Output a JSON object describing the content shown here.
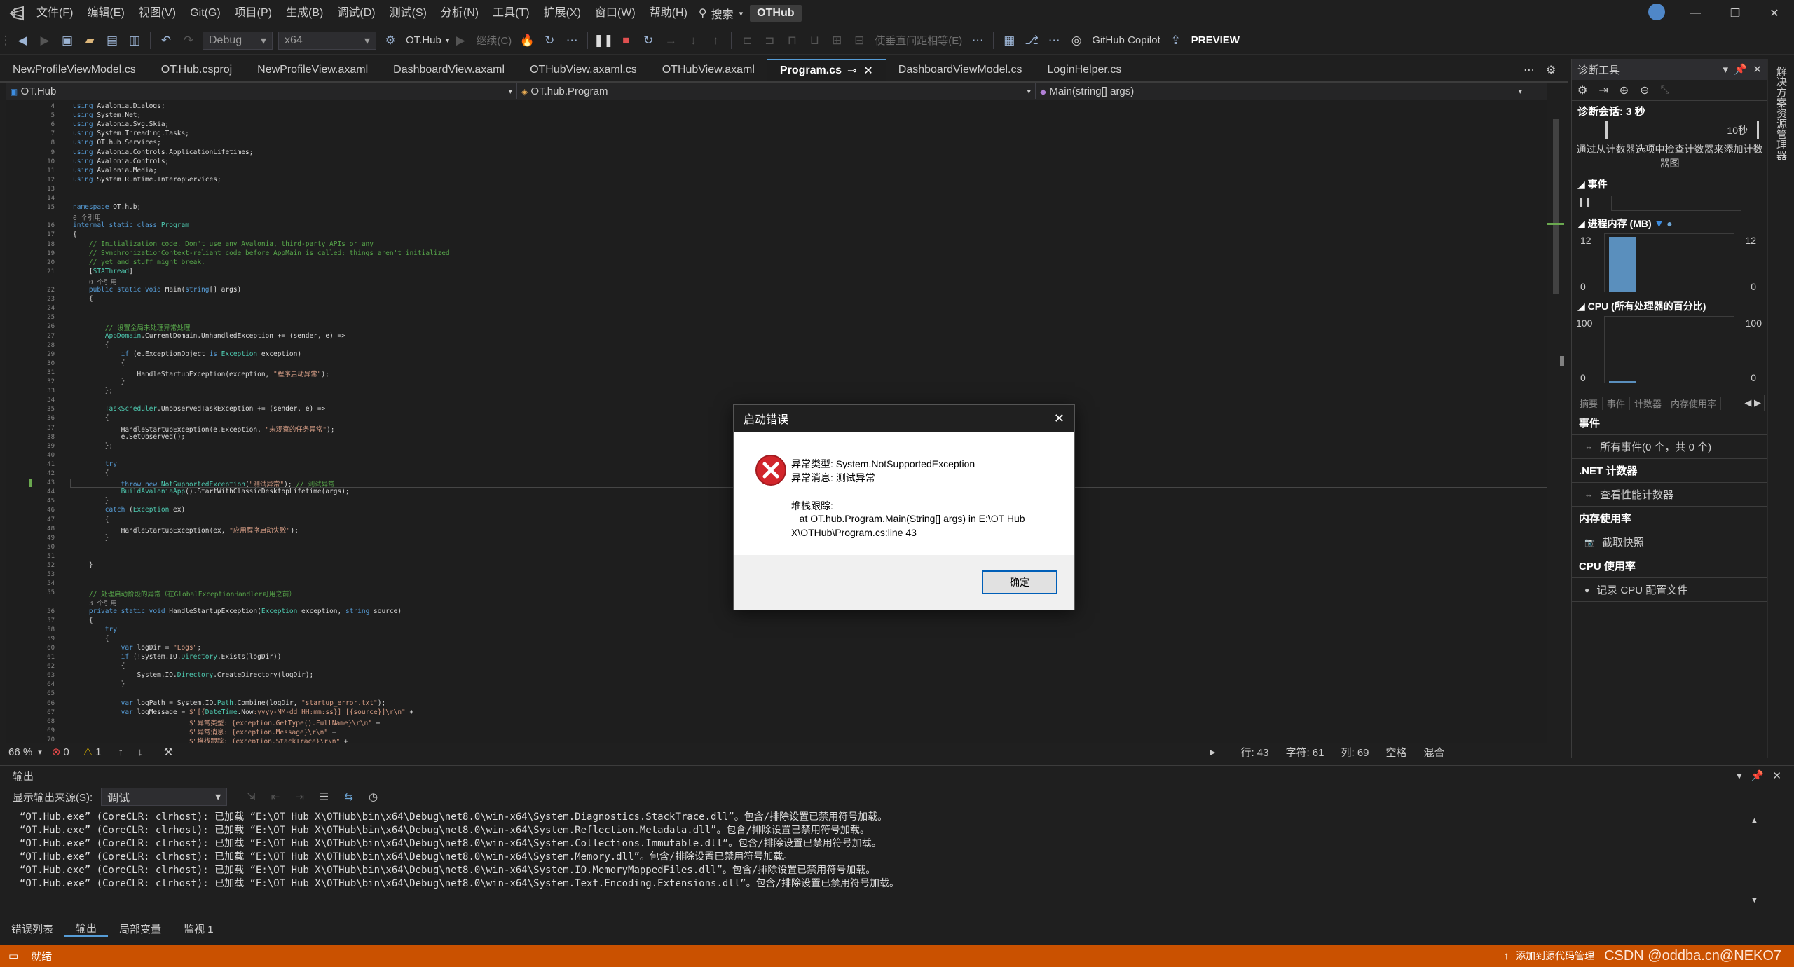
{
  "menubar": {
    "items": [
      "文件(F)",
      "编辑(E)",
      "视图(V)",
      "Git(G)",
      "项目(P)",
      "生成(B)",
      "调试(D)",
      "测试(S)",
      "分析(N)",
      "工具(T)",
      "扩展(X)",
      "窗口(W)",
      "帮助(H)"
    ],
    "search": "搜索",
    "solution": "OTHub"
  },
  "toolbar": {
    "config": "Debug",
    "platform": "x64",
    "startup": "OT.Hub",
    "continue": "继续(C)",
    "align": "使垂直间距相等(E)",
    "copilot": "GitHub Copilot",
    "preview": "PREVIEW"
  },
  "doctabs": [
    "NewProfileViewModel.cs",
    "OT.Hub.csproj",
    "NewProfileView.axaml",
    "DashboardView.axaml",
    "OTHubView.axaml.cs",
    "OTHubView.axaml",
    "Program.cs",
    "DashboardViewModel.cs",
    "LoginHelper.cs"
  ],
  "navbar": {
    "project": "OT.Hub",
    "class": "OT.hub.Program",
    "member": "Main(string[] args)"
  },
  "code": [
    {
      "n": "4",
      "t": "<span class='kw'>using</span> Avalonia.Dialogs;"
    },
    {
      "n": "5",
      "t": "<span class='kw'>using</span> System.Net;"
    },
    {
      "n": "6",
      "t": "<span class='kw'>using</span> Avalonia.Svg.Skia;"
    },
    {
      "n": "7",
      "t": "<span class='kw'>using</span> System.Threading.Tasks;"
    },
    {
      "n": "8",
      "t": "<span class='kw'>using</span> OT.hub.Services;"
    },
    {
      "n": "9",
      "t": "<span class='kw'>using</span> Avalonia.Controls.ApplicationLifetimes;"
    },
    {
      "n": "10",
      "t": "<span class='kw'>using</span> Avalonia.Controls;"
    },
    {
      "n": "11",
      "t": "<span class='kw'>using</span> Avalonia.Media;"
    },
    {
      "n": "12",
      "t": "<span class='kw'>using</span> System.Runtime.InteropServices;"
    },
    {
      "n": "13",
      "t": ""
    },
    {
      "n": "14",
      "t": ""
    },
    {
      "n": "15",
      "t": "<span class='kw'>namespace</span> OT.hub;"
    },
    {
      "n": "",
      "t": "<span class='ref'>0 个引用</span>"
    },
    {
      "n": "16",
      "t": "<span class='kw'>internal static class</span> <span class='ty'>Program</span>"
    },
    {
      "n": "17",
      "t": "{"
    },
    {
      "n": "18",
      "t": "    <span class='cm'>// Initialization code. Don't use any Avalonia, third-party APIs or any</span>"
    },
    {
      "n": "19",
      "t": "    <span class='cm'>// SynchronizationContext-reliant code before AppMain is called: things aren't initialized</span>"
    },
    {
      "n": "20",
      "t": "    <span class='cm'>// yet and stuff might break.</span>"
    },
    {
      "n": "21",
      "t": "    [<span class='ty'>STAThread</span>]"
    },
    {
      "n": "",
      "t": "    <span class='ref'>0 个引用</span>"
    },
    {
      "n": "22",
      "t": "    <span class='kw'>public static void</span> Main(<span class='kw'>string</span>[] args)"
    },
    {
      "n": "23",
      "t": "    {"
    },
    {
      "n": "24",
      "t": ""
    },
    {
      "n": "25",
      "t": ""
    },
    {
      "n": "26",
      "t": "        <span class='cm'>// 设置全局未处理异常处理</span>"
    },
    {
      "n": "27",
      "t": "        <span class='ty'>AppDomain</span>.CurrentDomain.UnhandledException += (sender, e) =>"
    },
    {
      "n": "28",
      "t": "        {"
    },
    {
      "n": "29",
      "t": "            <span class='kw'>if</span> (e.ExceptionObject <span class='kw'>is</span> <span class='ty'>Exception</span> exception)"
    },
    {
      "n": "30",
      "t": "            {"
    },
    {
      "n": "31",
      "t": "                HandleStartupException(exception, <span class='st'>\"程序启动异常\"</span>);"
    },
    {
      "n": "32",
      "t": "            }"
    },
    {
      "n": "33",
      "t": "        };"
    },
    {
      "n": "34",
      "t": ""
    },
    {
      "n": "35",
      "t": "        <span class='ty'>TaskScheduler</span>.UnobservedTaskException += (sender, e) =>"
    },
    {
      "n": "36",
      "t": "        {"
    },
    {
      "n": "37",
      "t": "            HandleStartupException(e.Exception, <span class='st'>\"未观察的任务异常\"</span>);"
    },
    {
      "n": "38",
      "t": "            e.SetObserved();"
    },
    {
      "n": "39",
      "t": "        };"
    },
    {
      "n": "40",
      "t": ""
    },
    {
      "n": "41",
      "t": "        <span class='kw'>try</span>"
    },
    {
      "n": "42",
      "t": "        {"
    },
    {
      "n": "43",
      "t": "            <span class='kw'>throw new</span> <span class='ty'>NotSupportedException</span>(<span class='st'>\"测试异常\"</span>); <span class='cm'>// 测试异常</span>"
    },
    {
      "n": "44",
      "t": "            <span class='ty'>BuildAvaloniaApp</span>().StartWithClassicDesktopLifetime(args);"
    },
    {
      "n": "45",
      "t": "        }"
    },
    {
      "n": "46",
      "t": "        <span class='kw'>catch</span> (<span class='ty'>Exception</span> ex)"
    },
    {
      "n": "47",
      "t": "        {"
    },
    {
      "n": "48",
      "t": "            HandleStartupException(ex, <span class='st'>\"应用程序启动失败\"</span>);"
    },
    {
      "n": "49",
      "t": "        }"
    },
    {
      "n": "50",
      "t": ""
    },
    {
      "n": "51",
      "t": ""
    },
    {
      "n": "52",
      "t": "    }"
    },
    {
      "n": "53",
      "t": ""
    },
    {
      "n": "54",
      "t": ""
    },
    {
      "n": "55",
      "t": "    <span class='cm'>// 处理启动阶段的异常（在GlobalExceptionHandler可用之前）</span>"
    },
    {
      "n": "",
      "t": "    <span class='ref'>3 个引用</span>"
    },
    {
      "n": "56",
      "t": "    <span class='kw'>private static void</span> HandleStartupException(<span class='ty'>Exception</span> exception, <span class='kw'>string</span> source)"
    },
    {
      "n": "57",
      "t": "    {"
    },
    {
      "n": "58",
      "t": "        <span class='kw'>try</span>"
    },
    {
      "n": "59",
      "t": "        {"
    },
    {
      "n": "60",
      "t": "            <span class='kw'>var</span> logDir = <span class='st'>\"Logs\"</span>;"
    },
    {
      "n": "61",
      "t": "            <span class='kw'>if</span> (!System.IO.<span class='ty'>Directory</span>.Exists(logDir))"
    },
    {
      "n": "62",
      "t": "            {"
    },
    {
      "n": "63",
      "t": "                System.IO.<span class='ty'>Directory</span>.CreateDirectory(logDir);"
    },
    {
      "n": "64",
      "t": "            }"
    },
    {
      "n": "65",
      "t": ""
    },
    {
      "n": "66",
      "t": "            <span class='kw'>var</span> logPath = System.IO.<span class='ty'>Path</span>.Combine(logDir, <span class='st'>\"startup_error.txt\"</span>);"
    },
    {
      "n": "67",
      "t": "            <span class='kw'>var</span> logMessage = <span class='st'>$\"[{</span><span class='ty'>DateTime</span>.Now<span class='st'>:yyyy-MM-dd HH:mm:ss}] [{source}]\\r\\n\"</span> +"
    },
    {
      "n": "68",
      "t": "                             <span class='st'>$\"异常类型: {exception.GetType().FullName}\\r\\n\"</span> +"
    },
    {
      "n": "69",
      "t": "                             <span class='st'>$\"异常消息: {exception.Message}\\r\\n\"</span> +"
    },
    {
      "n": "70",
      "t": "                             <span class='st'>$\"堆栈跟踪: {exception.StackTrace}\\r\\n\"</span> +"
    }
  ],
  "editor_status": {
    "zoom": "66 %",
    "errors": "0",
    "warnings": "1",
    "line": "行: 43",
    "char": "字符: 61",
    "col": "列: 69",
    "ws": "空格",
    "eol": "混合"
  },
  "diag": {
    "title": "诊断工具",
    "session": "诊断会话: 3 秒",
    "timeline": "10秒",
    "hint": "通过从计数器选项中检查计数器来添加计数器图",
    "events": "事件",
    "memory": "进程内存 (MB)",
    "mem_max": "12",
    "mem_min": "0",
    "mem_level": 0.95,
    "cpu": "CPU (所有处理器的百分比)",
    "cpu_max": "100",
    "cpu_min": "0",
    "tabs": [
      "摘要",
      "事件",
      "计数器",
      "内存使用率"
    ],
    "sections": [
      {
        "h": "事件",
        "item": "所有事件(0 个，共 0 个)"
      },
      {
        "h": ".NET 计数器",
        "item": "查看性能计数器"
      },
      {
        "h": "内存使用率",
        "item": "截取快照"
      },
      {
        "h": "CPU 使用率",
        "item": "记录 CPU 配置文件"
      }
    ],
    "side": "解决方案资源管理器"
  },
  "output": {
    "title": "输出",
    "source_label": "显示输出来源(S):",
    "source_value": "调试",
    "lines": [
      "“OT.Hub.exe” (CoreCLR: clrhost): 已加载 “E:\\OT Hub X\\OTHub\\bin\\x64\\Debug\\net8.0\\win-x64\\System.Diagnostics.StackTrace.dll”。包含/排除设置已禁用符号加载。",
      "“OT.Hub.exe” (CoreCLR: clrhost): 已加载 “E:\\OT Hub X\\OTHub\\bin\\x64\\Debug\\net8.0\\win-x64\\System.Reflection.Metadata.dll”。包含/排除设置已禁用符号加载。",
      "“OT.Hub.exe” (CoreCLR: clrhost): 已加载 “E:\\OT Hub X\\OTHub\\bin\\x64\\Debug\\net8.0\\win-x64\\System.Collections.Immutable.dll”。包含/排除设置已禁用符号加载。",
      "“OT.Hub.exe” (CoreCLR: clrhost): 已加载 “E:\\OT Hub X\\OTHub\\bin\\x64\\Debug\\net8.0\\win-x64\\System.Memory.dll”。包含/排除设置已禁用符号加载。",
      "“OT.Hub.exe” (CoreCLR: clrhost): 已加载 “E:\\OT Hub X\\OTHub\\bin\\x64\\Debug\\net8.0\\win-x64\\System.IO.MemoryMappedFiles.dll”。包含/排除设置已禁用符号加载。",
      "“OT.Hub.exe” (CoreCLR: clrhost): 已加载 “E:\\OT Hub X\\OTHub\\bin\\x64\\Debug\\net8.0\\win-x64\\System.Text.Encoding.Extensions.dll”。包含/排除设置已禁用符号加载。"
    ]
  },
  "bottomtabs": [
    "错误列表",
    "输出",
    "局部变量",
    "监视 1"
  ],
  "status": {
    "ready": "就绪",
    "source": "添加到源代码管理",
    "watermark": "CSDN @oddba.cn@NEKO7"
  },
  "dialog": {
    "title": "启动错误",
    "type": "异常类型: System.NotSupportedException",
    "msg": "异常消息: 测试异常",
    "trace_h": "堆栈跟踪:",
    "trace1": "   at OT.hub.Program.Main(String[] args) in E:\\OT Hub",
    "trace2": "X\\OTHub\\Program.cs:line 43",
    "ok": "确定"
  }
}
